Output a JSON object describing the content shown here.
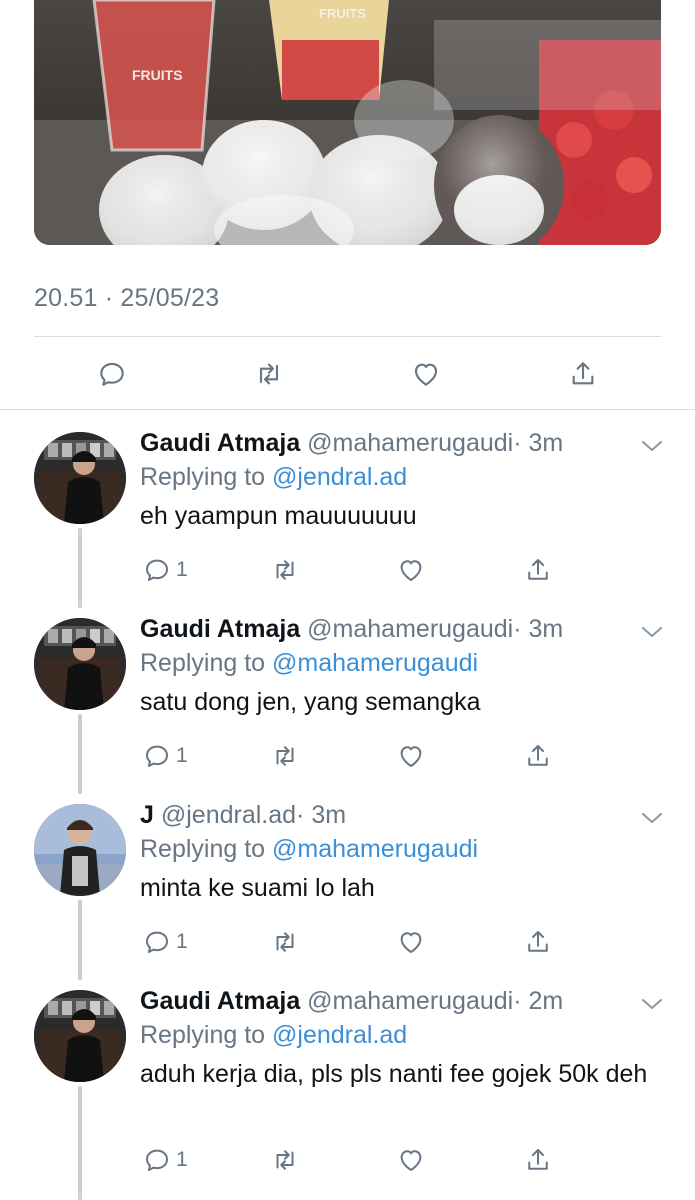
{
  "tweet": {
    "timestamp": "20.51 · 25/05/23",
    "photo_label_1": "FRUITS",
    "photo_label_2": "FRUITS"
  },
  "icons": {
    "reply": "reply-icon",
    "retweet": "retweet-icon",
    "like": "heart-icon",
    "share": "share-icon",
    "more": "chevron-down-icon"
  },
  "colors": {
    "mention": "#3c8ed6",
    "muted": "#687684",
    "thread_line": "#c4cfd6"
  },
  "replies": [
    {
      "name": "Gaudi Atmaja",
      "handle": "@mahamerugaudi",
      "time": "· 3m",
      "replying_prefix": "Replying to ",
      "replying_to": "@jendral.ad",
      "text": "eh yaampun mauuuuuuu",
      "reply_count": "1"
    },
    {
      "name": "Gaudi Atmaja",
      "handle": "@mahamerugaudi",
      "time": "· 3m",
      "replying_prefix": "Replying to ",
      "replying_to": "@mahamerugaudi",
      "text": "satu dong jen, yang semangka",
      "reply_count": "1"
    },
    {
      "name": "J",
      "handle": "@jendral.ad",
      "time": "· 3m",
      "replying_prefix": "Replying to ",
      "replying_to": "@mahamerugaudi",
      "text": "minta ke suami lo lah",
      "reply_count": "1"
    },
    {
      "name": "Gaudi Atmaja",
      "handle": "@mahamerugaudi",
      "time": "· 2m",
      "replying_prefix": "Replying to ",
      "replying_to": "@jendral.ad",
      "text": "aduh kerja dia, pls pls nanti fee gojek 50k deh",
      "reply_count": "1"
    }
  ]
}
